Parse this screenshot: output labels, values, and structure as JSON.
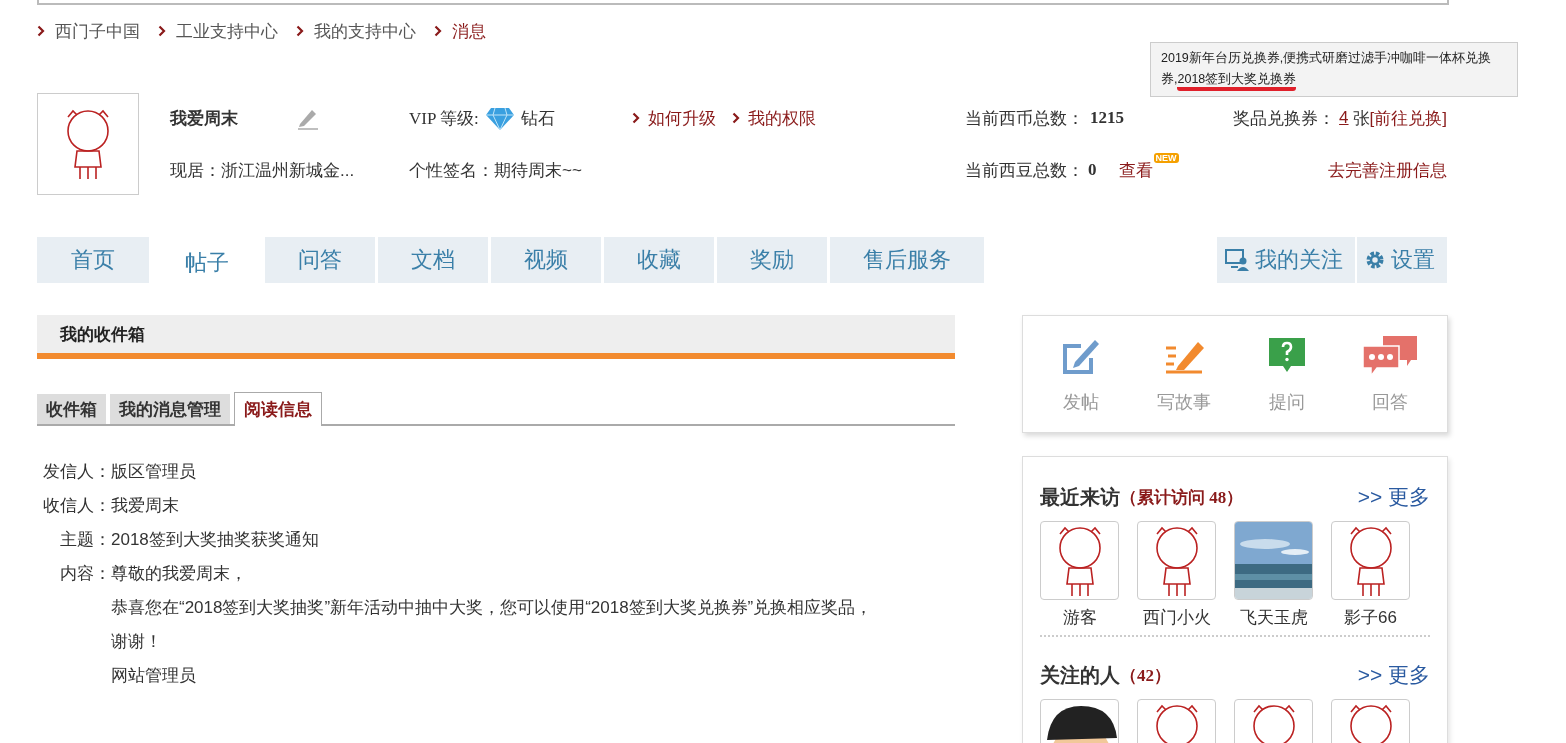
{
  "breadcrumb": [
    {
      "label": "西门子中国",
      "current": false
    },
    {
      "label": "工业支持中心",
      "current": false
    },
    {
      "label": "我的支持中心",
      "current": false
    },
    {
      "label": "消息",
      "current": true
    }
  ],
  "tooltip": {
    "segments": [
      {
        "text": "2019新年台历兑换券,便携式研磨过滤手冲咖啡一体杯兑换券,",
        "marked": false
      },
      {
        "text": "2018签到大奖兑换券",
        "marked": true
      }
    ]
  },
  "profile": {
    "name": "我爱周末",
    "location_label": "现居：",
    "location": "浙江温州新城金...",
    "vip_label": "VIP 等级:",
    "vip_level": "钻石",
    "signature_label": "个性签名：",
    "signature": "期待周末~~",
    "links": [
      "如何升级",
      "我的权限"
    ],
    "coins_label": "当前西币总数：",
    "coins": "1215",
    "beans_label": "当前西豆总数：",
    "beans": "0",
    "view_link": "查看",
    "new_badge": "NEW",
    "vouchers_label": "奖品兑换券：",
    "vouchers_count": "4",
    "vouchers_unit": "张",
    "vouchers_link": "[前往兑换]",
    "complete_link": "去完善注册信息"
  },
  "nav_tabs": [
    {
      "label": "首页",
      "selected": false
    },
    {
      "label": "帖子",
      "selected": true
    },
    {
      "label": "问答",
      "selected": false
    },
    {
      "label": "文档",
      "selected": false
    },
    {
      "label": "视频",
      "selected": false
    },
    {
      "label": "收藏",
      "selected": false
    },
    {
      "label": "奖励",
      "selected": false
    },
    {
      "label": "售后服务",
      "selected": false
    }
  ],
  "nav_right": [
    {
      "label": "我的关注",
      "kind": "follow"
    },
    {
      "label": "设置",
      "kind": "settings"
    }
  ],
  "inbox": {
    "title": "我的收件箱",
    "tabs": [
      {
        "label": "收件箱",
        "selected": false
      },
      {
        "label": "我的消息管理",
        "selected": false
      },
      {
        "label": "阅读信息",
        "selected": true
      }
    ],
    "fields": [
      {
        "label": "发信人：",
        "value": "版区管理员"
      },
      {
        "label": "收信人：",
        "value": "我爱周末"
      },
      {
        "label": "主题：",
        "value": "2018签到大奖抽奖获奖通知"
      }
    ],
    "content_label": "内容：",
    "content_lines": [
      "尊敬的我爱周末，",
      "恭喜您在“2018签到大奖抽奖”新年活动中抽中大奖，您可以使用“2018签到大奖兑换券”兑换相应奖品，",
      "谢谢！",
      "网站管理员"
    ]
  },
  "actions": [
    {
      "label": "发帖",
      "kind": "post"
    },
    {
      "label": "写故事",
      "kind": "story"
    },
    {
      "label": "提问",
      "kind": "ask"
    },
    {
      "label": "回答",
      "kind": "answer"
    }
  ],
  "visitors": {
    "title": "最近来访",
    "count": "（累计访问 48）",
    "more": ">> 更多",
    "people": [
      {
        "name": "游客",
        "kind": "avatar"
      },
      {
        "name": "西门小火",
        "kind": "avatar"
      },
      {
        "name": "飞天玉虎",
        "kind": "picture"
      },
      {
        "name": "影子66",
        "kind": "avatar"
      }
    ]
  },
  "following": {
    "title": "关注的人",
    "count": "（42）",
    "more": ">> 更多",
    "people": [
      {
        "kind": "cap"
      },
      {
        "kind": "avatar"
      },
      {
        "kind": "avatar"
      },
      {
        "kind": "avatar"
      }
    ]
  }
}
